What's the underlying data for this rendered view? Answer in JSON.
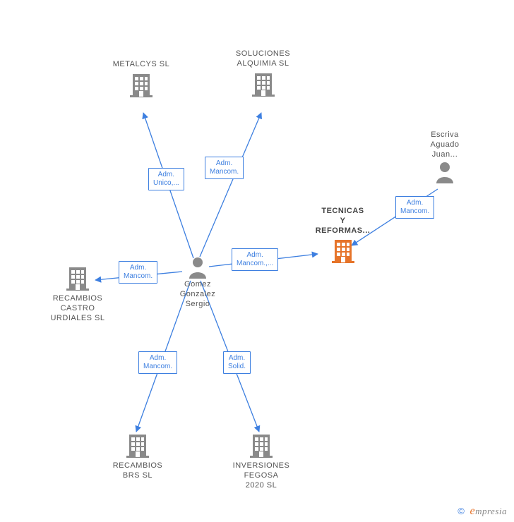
{
  "nodes": {
    "center_person": {
      "label": "Gomez\nGonzalez\nSergio"
    },
    "metalcys": {
      "label": "METALCYS  SL"
    },
    "soluciones": {
      "label": "SOLUCIONES\nALQUIMIA  SL"
    },
    "escriva": {
      "label": "Escriva\nAguado\nJuan..."
    },
    "tecnicas": {
      "label": "TECNICAS\nY\nREFORMAS..."
    },
    "recambios_cu": {
      "label": "RECAMBIOS\nCASTRO\nURDIALES  SL"
    },
    "recambios_brs": {
      "label": "RECAMBIOS\nBRS  SL"
    },
    "inversiones": {
      "label": "INVERSIONES\nFEGOSA\n2020  SL"
    }
  },
  "edges": {
    "e_metalcys": {
      "label": "Adm.\nUnico,..."
    },
    "e_soluciones": {
      "label": "Adm.\nMancom."
    },
    "e_tecnicas": {
      "label": "Adm.\nMancom.,..."
    },
    "e_recamb_cu": {
      "label": "Adm.\nMancom."
    },
    "e_recamb_brs": {
      "label": "Adm.\nMancom."
    },
    "e_inversiones": {
      "label": "Adm.\nSolid."
    },
    "e_escriva": {
      "label": "Adm.\nMancom."
    }
  },
  "watermark": {
    "copyright": "©",
    "e": "e",
    "rest": "mpresia"
  },
  "colors": {
    "gray": "#8a8a8a",
    "orange": "#e6742a",
    "blue": "#3d7fe0"
  }
}
